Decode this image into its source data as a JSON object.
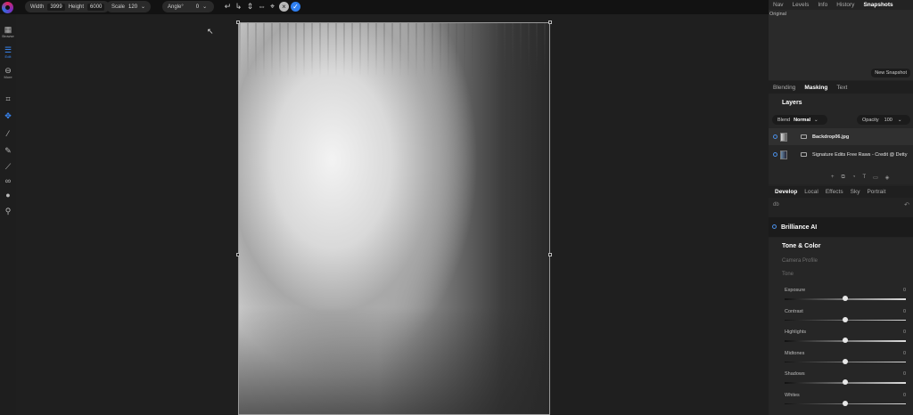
{
  "toolbar": {
    "width_label": "Width",
    "width_value": "3999",
    "height_label": "Height",
    "height_value": "6000",
    "scale_label": "Scale",
    "scale_value": "120",
    "angle_label": "Angle°",
    "angle_value": "0"
  },
  "leftbar": {
    "items": [
      {
        "label": "Browse"
      },
      {
        "label": "Edit"
      },
      {
        "label": "More"
      }
    ]
  },
  "right_panel": {
    "top_tabs": [
      "Nav",
      "Levels",
      "Info",
      "History",
      "Snapshots"
    ],
    "snapshot_original": "Original",
    "new_snapshot": "New Snapshot",
    "mask_tabs": [
      "Blending",
      "Masking",
      "Text"
    ],
    "layers_title": "Layers",
    "blend_label": "Blend",
    "blend_value": "Normal",
    "opacity_label": "Opacity",
    "opacity_value": "100",
    "layers": [
      {
        "name": "Backdrop06.jpg"
      },
      {
        "name": "Signature Edits Free Raws - Credit @ Detty"
      }
    ],
    "dev_tabs": [
      "Develop",
      "Local",
      "Effects",
      "Sky",
      "Portrait"
    ],
    "dev_sub": "db",
    "brilliance": "Brilliance AI",
    "tone_color_title": "Tone & Color",
    "camera_profile": "Camera Profile",
    "tone": "Tone",
    "sliders": [
      {
        "label": "Exposure",
        "value": "0",
        "pos": 0.5
      },
      {
        "label": "Contrast",
        "value": "0",
        "pos": 0.5
      },
      {
        "label": "Highlights",
        "value": "0",
        "pos": 0.5
      },
      {
        "label": "Midtones",
        "value": "0",
        "pos": 0.5
      },
      {
        "label": "Shadows",
        "value": "0",
        "pos": 0.5
      },
      {
        "label": "Whites",
        "value": "0",
        "pos": 0.5
      }
    ]
  }
}
